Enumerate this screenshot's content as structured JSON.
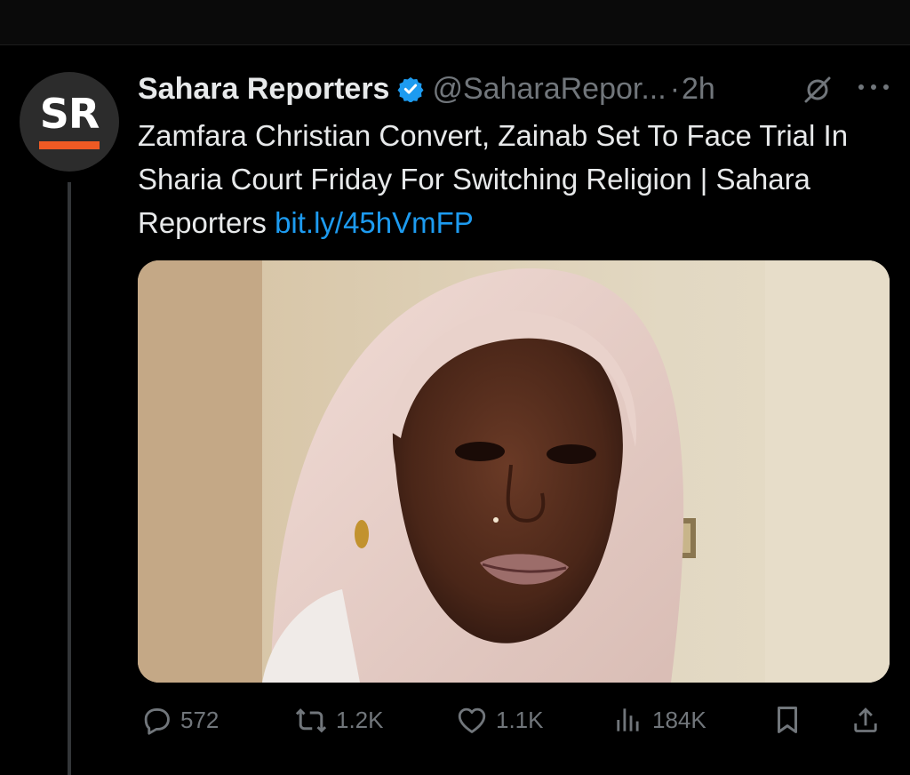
{
  "tweet": {
    "author": {
      "avatar_text": "SR",
      "display_name": "Sahara Reporters",
      "handle": "@SaharaRepor...",
      "separator": "·",
      "time": "2h"
    },
    "text": "Zamfara Christian Convert, Zainab Set To Face Trial In Sharia Court Friday For Switching Religion | Sahara Reporters",
    "link": "bit.ly/45hVmFP",
    "media": {
      "description": "photo"
    },
    "stats": {
      "replies": "572",
      "reposts": "1.2K",
      "likes": "1.1K",
      "views": "184K"
    }
  },
  "icons": {
    "verified": "verified-badge-icon",
    "grok": "grok-icon",
    "more": "more-icon",
    "reply": "reply-icon",
    "repost": "repost-icon",
    "like": "like-icon",
    "views": "views-icon",
    "bookmark": "bookmark-icon",
    "share": "share-icon"
  },
  "colors": {
    "background": "#000000",
    "text": "#e7e9ea",
    "muted": "#71767b",
    "link": "#1d9bf0",
    "brand_bar": "#ee5a24"
  }
}
